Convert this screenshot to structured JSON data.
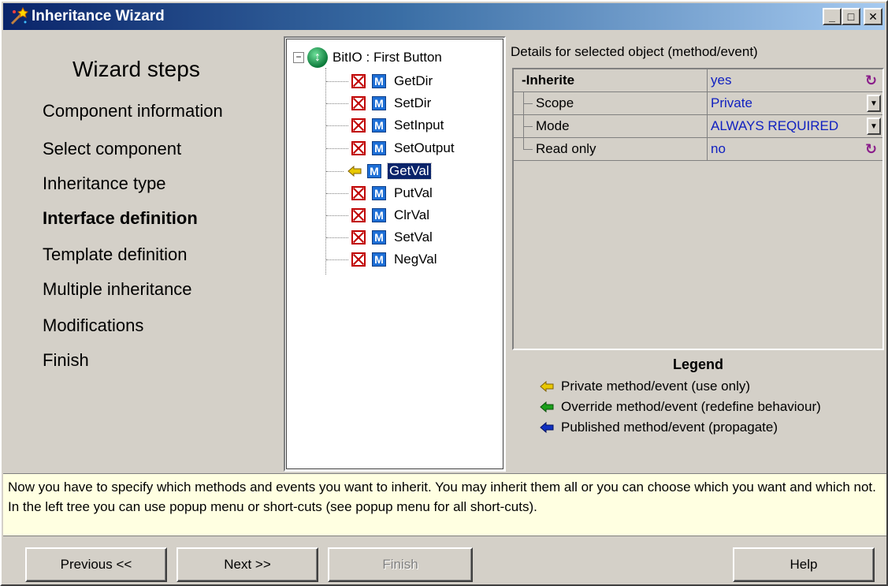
{
  "window": {
    "title": "Inheritance Wizard",
    "controls": {
      "minimize": "_",
      "maximize": "□",
      "close": "✕"
    }
  },
  "steps": {
    "title": "Wizard steps",
    "items": [
      {
        "label": "Component information",
        "current": false
      },
      {
        "label": "Select component",
        "current": false
      },
      {
        "label": "Inheritance type",
        "current": false
      },
      {
        "label": "Interface definition",
        "current": true
      },
      {
        "label": "Template definition",
        "current": false
      },
      {
        "label": "Multiple inheritance",
        "current": false
      },
      {
        "label": "Modifications",
        "current": false
      },
      {
        "label": "Finish",
        "current": false
      }
    ]
  },
  "tree": {
    "expander": "−",
    "root_label": "BitIO : First Button",
    "items": [
      {
        "label": "GetDir",
        "state": "excluded"
      },
      {
        "label": "SetDir",
        "state": "excluded"
      },
      {
        "label": "SetInput",
        "state": "excluded"
      },
      {
        "label": "SetOutput",
        "state": "excluded"
      },
      {
        "label": "GetVal",
        "state": "private",
        "selected": true
      },
      {
        "label": "PutVal",
        "state": "excluded"
      },
      {
        "label": "ClrVal",
        "state": "excluded"
      },
      {
        "label": "SetVal",
        "state": "excluded"
      },
      {
        "label": "NegVal",
        "state": "excluded"
      }
    ],
    "m_badge": "M"
  },
  "details": {
    "heading": "Details for selected object (method/event)",
    "rows": [
      {
        "name": "-Inherite",
        "value": "yes"
      },
      {
        "name": "Scope",
        "value": "Private"
      },
      {
        "name": "Mode",
        "value": "ALWAYS REQUIRED"
      },
      {
        "name": "Read only",
        "value": "no"
      }
    ]
  },
  "legend": {
    "title": "Legend",
    "items": [
      {
        "label": "Private method/event (use only)",
        "color": "#e8c800"
      },
      {
        "label": "Override method/event (redefine behaviour)",
        "color": "#1aa01a"
      },
      {
        "label": "Published method/event (propagate)",
        "color": "#1030c0"
      }
    ]
  },
  "info": {
    "text": "Now you have to specify which methods and events you want to inherit. You may inherit them all or you can choose which you want and which not. In the left tree you can use popup menu or short-cuts (see popup menu for all short-cuts)."
  },
  "buttons": {
    "previous": "Previous <<",
    "next": "Next >>",
    "finish": "Finish",
    "help": "Help"
  }
}
